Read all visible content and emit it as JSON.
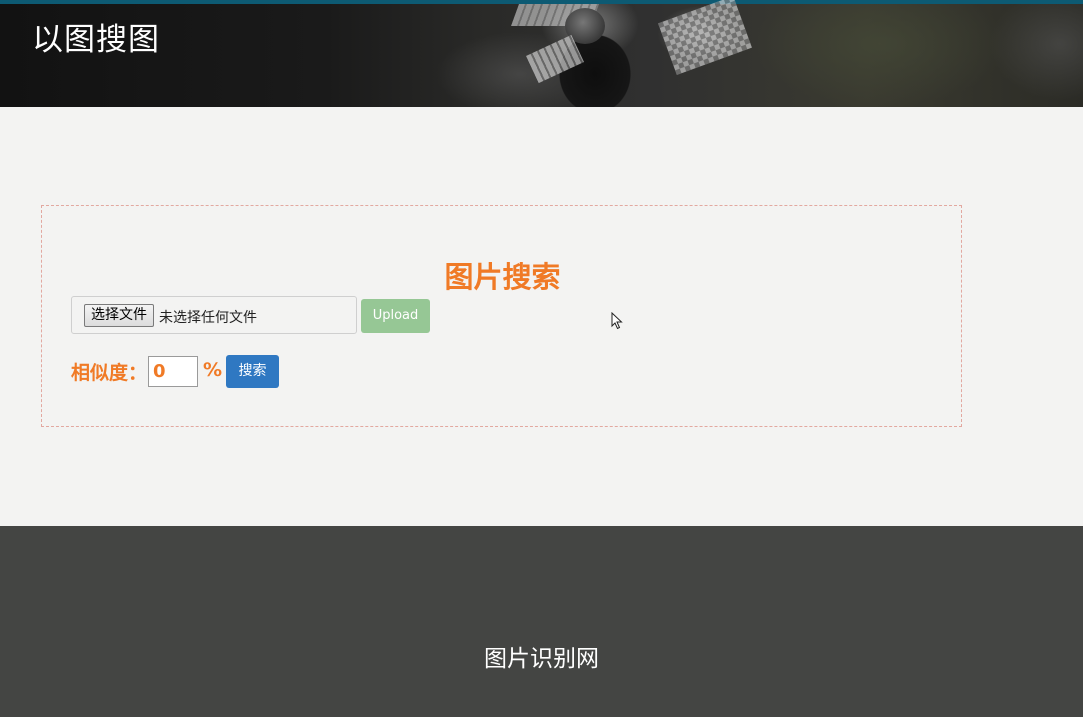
{
  "header": {
    "title": "以图搜图"
  },
  "search": {
    "title": "图片搜索",
    "file_button_label": "选择文件",
    "file_status": "未选择任何文件",
    "upload_label": "Upload",
    "similarity_label": "相似度：",
    "similarity_value": "0",
    "percent_sign": "%",
    "search_button_label": "搜索"
  },
  "footer": {
    "text": "图片识别网"
  },
  "colors": {
    "accent": "#f07a26",
    "upload_button": "#96c795",
    "search_button": "#2f78c2",
    "footer_bg": "#444543"
  }
}
